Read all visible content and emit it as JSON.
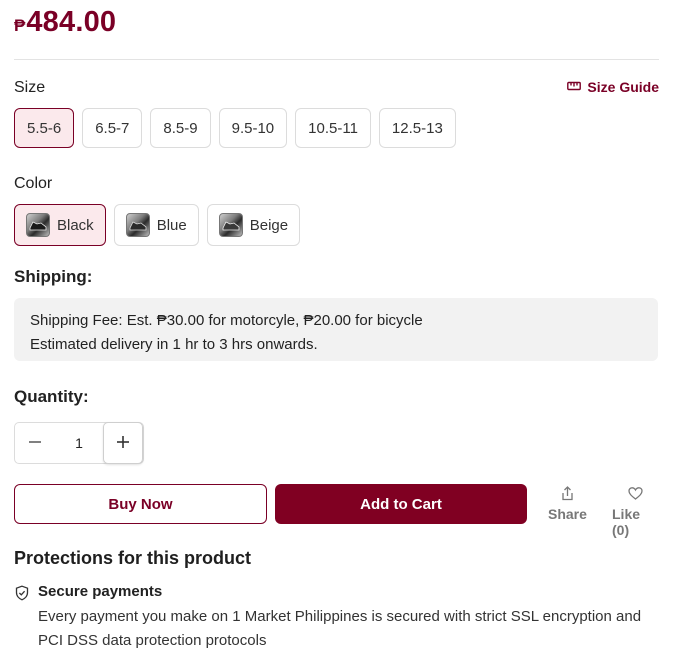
{
  "price": {
    "currency": "₱",
    "amount": "484.00"
  },
  "size": {
    "label": "Size",
    "guide_label": "Size Guide",
    "options": [
      "5.5-6",
      "6.5-7",
      "8.5-9",
      "9.5-10",
      "10.5-11",
      "12.5-13"
    ],
    "selected": "5.5-6"
  },
  "color": {
    "label": "Color",
    "options": [
      "Black",
      "Blue",
      "Beige"
    ],
    "selected": "Black"
  },
  "shipping": {
    "label": "Shipping:",
    "fee_text": "Shipping Fee: Est. ₱30.00 for motorcyle, ₱20.00 for bicycle",
    "delivery_text": "Estimated delivery in 1 hr to 3 hrs onwards."
  },
  "quantity": {
    "label": "Quantity:",
    "value": "1"
  },
  "actions": {
    "buy_now": "Buy Now",
    "add_to_cart": "Add to Cart",
    "share": "Share",
    "like": "Like (0)"
  },
  "protections": {
    "title": "Protections for this product",
    "items": [
      {
        "name": "Secure payments",
        "description": "Every payment you make on 1 Market Philippines is secured with strict SSL encryption and PCI DSS data protection protocols",
        "icon": "shield-check-icon"
      }
    ]
  },
  "colors": {
    "accent": "#7a0026",
    "accent_dark": "#800022",
    "selected_bg": "#fbe9ec"
  }
}
